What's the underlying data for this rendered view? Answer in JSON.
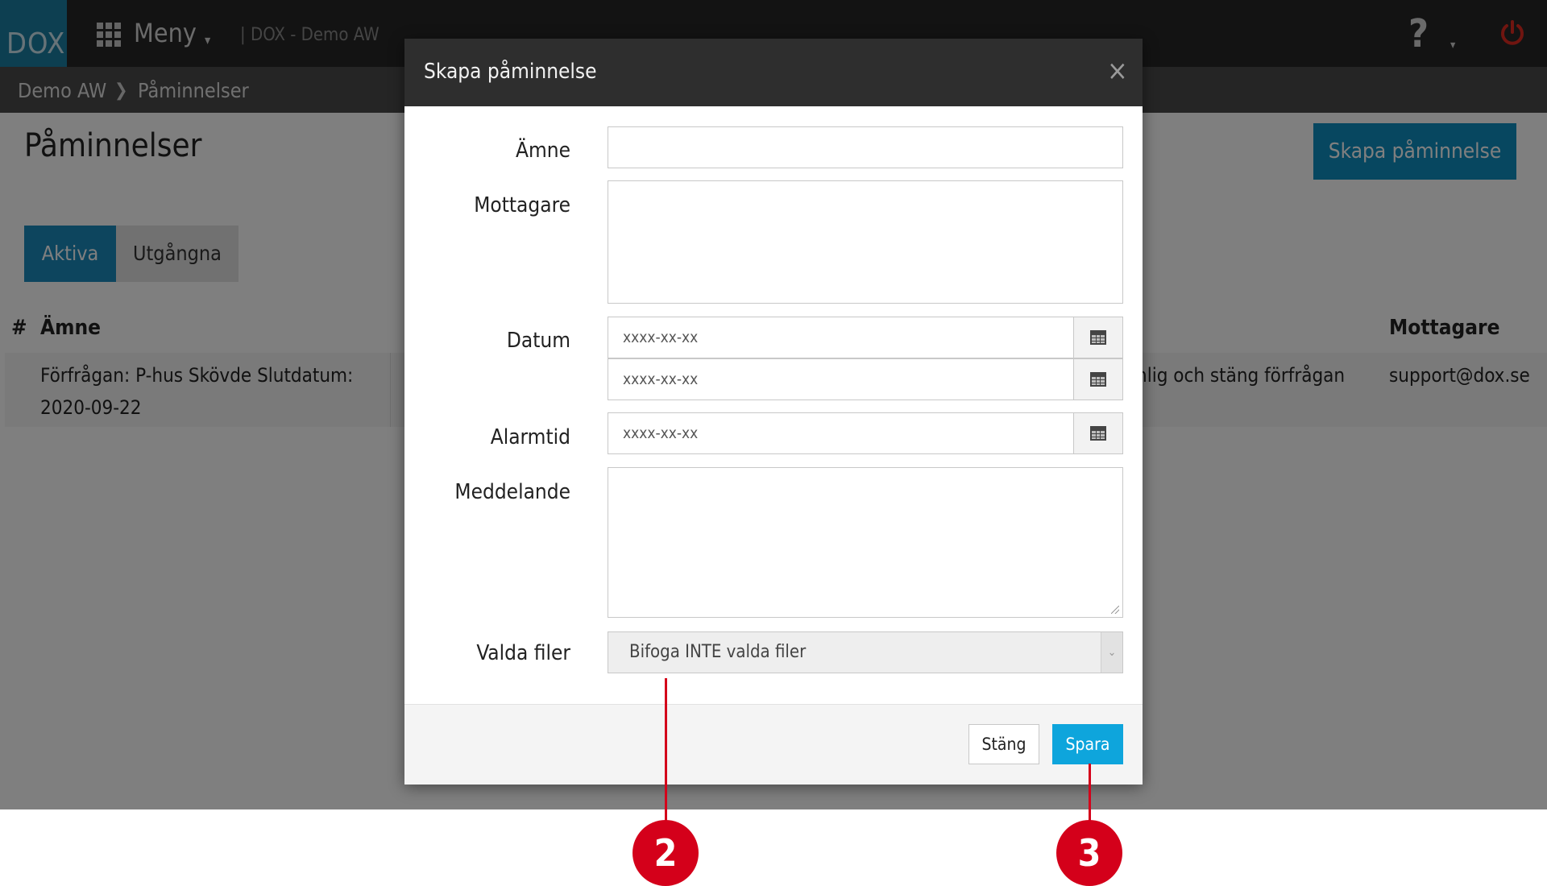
{
  "navbar": {
    "logo": "DOX",
    "menu_label": "Meny",
    "app_name": "| DOX - Demo AW",
    "help_symbol": "?",
    "icons": [
      "grid-icon",
      "chevron-down-icon",
      "help-icon",
      "power-icon"
    ]
  },
  "breadcrumb": {
    "items": [
      "Demo AW",
      "Påminnelser"
    ],
    "separator": ">"
  },
  "page": {
    "title": "Påminnelser",
    "create_button": "Skapa påminnelse",
    "tabs": [
      {
        "label": "Aktiva",
        "active": true
      },
      {
        "label": "Utgångna",
        "active": false
      }
    ]
  },
  "table": {
    "headers": [
      "#",
      "Ämne",
      "Mottagare"
    ],
    "rows": [
      {
        "subject_line1": "Förfrågan: P-hus Skövde Slutdatum:",
        "subject_line2": "2020-09-22",
        "action": "nlig och stäng förfrågan",
        "recipient": "support@dox.se"
      }
    ]
  },
  "modal": {
    "title": "Skapa påminnelse",
    "close_symbol": "×",
    "labels": {
      "subject": "Ämne",
      "recipients": "Mottagare",
      "date": "Datum",
      "alarm": "Alarmtid",
      "message": "Meddelande",
      "files": "Valda filer"
    },
    "date_placeholder_1": "xxxx-xx-xx",
    "date_placeholder_2": "xxxx-xx-xx",
    "alarm_placeholder": "xxxx-xx-xx",
    "files_selected": "Bifoga INTE valda filer",
    "close_button": "Stäng",
    "save_button": "Spara"
  },
  "annotations": {
    "callout_2": "2",
    "callout_3": "3",
    "color": "#d4001a"
  },
  "colors": {
    "primary": "#0ea5dc",
    "navbar": "#262626",
    "logo_bg": "#1a7fa3",
    "power": "#e02b20"
  }
}
